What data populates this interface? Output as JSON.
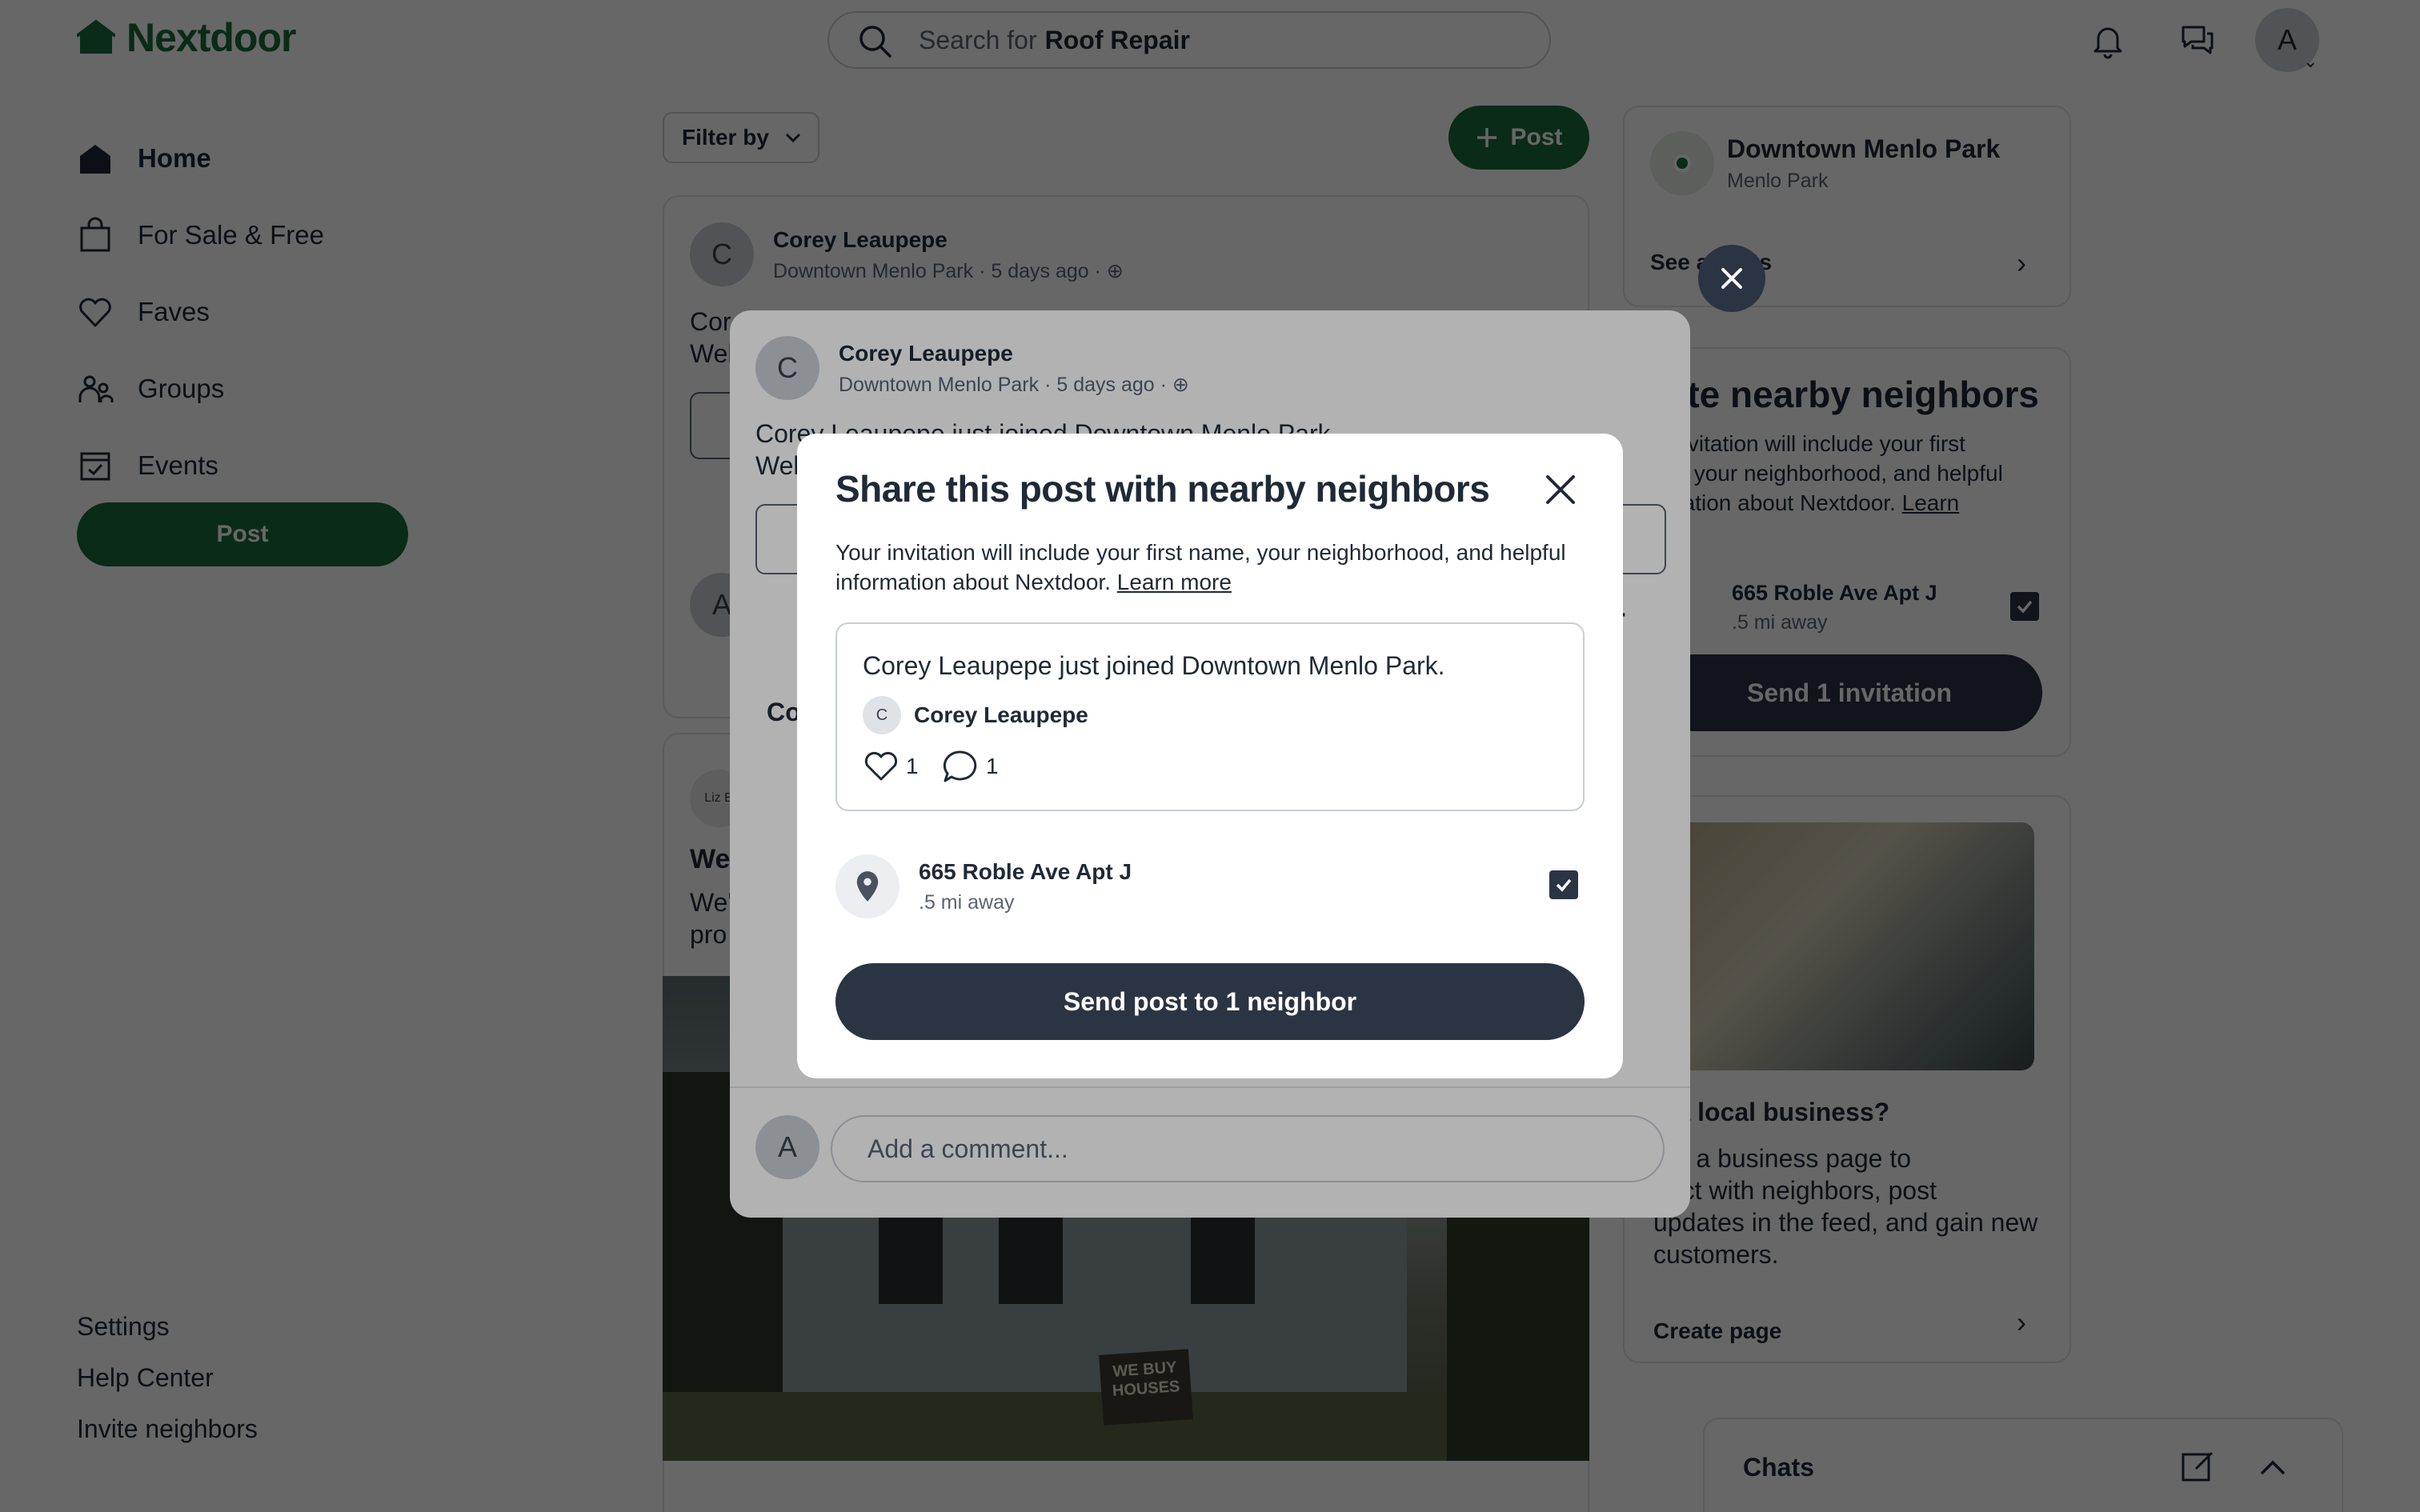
{
  "app": {
    "name": "Nextdoor",
    "brand_color": "#1b6b3a",
    "dark_color": "#2b3442"
  },
  "topbar": {
    "search_prefix": "Search for",
    "search_term": "Roof Repair",
    "avatar_initial": "A",
    "icons": [
      "bell-icon",
      "chat-bubbles-icon"
    ]
  },
  "sidebar": {
    "items": [
      {
        "label": "Home",
        "icon": "home-icon"
      },
      {
        "label": "For Sale & Free",
        "icon": "shopping-bag-icon"
      },
      {
        "label": "Faves",
        "icon": "heart-icon"
      },
      {
        "label": "Groups",
        "icon": "groups-icon"
      },
      {
        "label": "Events",
        "icon": "calendar-icon"
      }
    ],
    "post_label": "Post",
    "footer": [
      "Settings",
      "Help Center",
      "Invite neighbors"
    ]
  },
  "feed": {
    "filter_label": "Filter by",
    "post_label": "Post",
    "post1": {
      "initial": "C",
      "author": "Corey Leaupepe",
      "location": "Downtown Menlo Park",
      "time": "5 days ago",
      "text_line1": "Cor",
      "text_line2": "Wel"
    },
    "post2": {
      "headline": "We",
      "body_line1": "We'",
      "body_line2": "pro",
      "sign_text": "WE BUY HOUSES"
    }
  },
  "right": {
    "neighborhood": "Downtown Menlo Park",
    "city": "Menlo Park",
    "see_all": "See a",
    "see_all_tail": "ts",
    "invite_title": "vite nearby neighbors",
    "invite_desc_1": "r invitation will include your first",
    "invite_desc_2": "ne, your neighborhood, and helpful",
    "invite_desc_3": "rmation about Nextdoor.",
    "invite_learn": "Learn",
    "invite_learn_tail": "e",
    "address": "665 Roble Ave Apt J",
    "distance": ".5 mi away",
    "send_invite": "Send 1 invitation",
    "biz_title": "n a local business?",
    "biz_desc_1": "ate a business page to",
    "biz_desc_2": "nect with neighbors, post",
    "biz_desc_3": "updates in the feed, and gain new",
    "biz_desc_4": "customers.",
    "create_page": "Create page",
    "chats": "Chats"
  },
  "post_modal": {
    "initial": "C",
    "author": "Corey Leaupepe",
    "location": "Downtown Menlo Park",
    "time": "5 days ago",
    "text_line1": "Corey Leaupepe just joined Downtown Menlo Park.",
    "text_line2": "Wel",
    "comments_prefix": "Co",
    "comment_initial": "A",
    "comment_placeholder": "Add a comment..."
  },
  "share_dialog": {
    "title": "Share this post with nearby neighbors",
    "desc": "Your invitation will include your first name, your neighborhood, and helpful information about Nextdoor.",
    "learn_more": "Learn more",
    "preview_text": "Corey Leaupepe just joined Downtown Menlo Park.",
    "preview_initial": "C",
    "preview_author": "Corey Leaupepe",
    "likes": "1",
    "comments": "1",
    "address": "665 Roble Ave Apt J",
    "distance": ".5 mi away",
    "checked": true,
    "send_label": "Send post to 1 neighbor"
  }
}
